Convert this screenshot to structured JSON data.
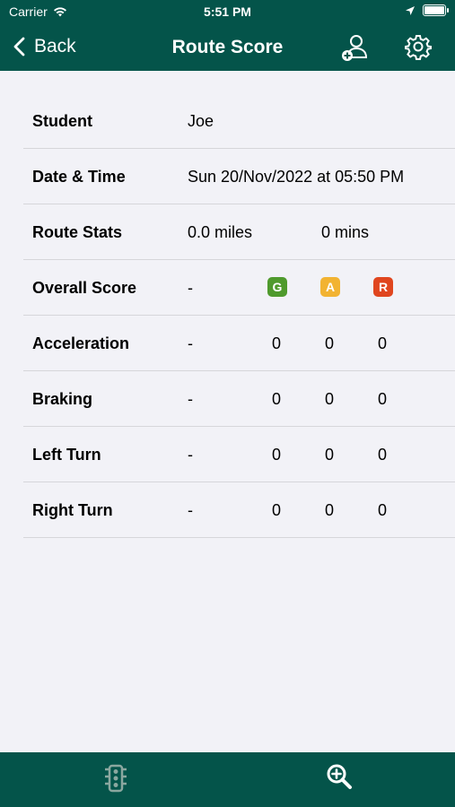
{
  "status_bar": {
    "carrier": "Carrier",
    "time": "5:51 PM"
  },
  "nav": {
    "back_label": "Back",
    "title": "Route Score",
    "icons": [
      "add-user-icon",
      "gear-icon"
    ]
  },
  "details": {
    "student": {
      "label": "Student",
      "value": "Joe"
    },
    "date_time": {
      "label": "Date & Time",
      "value": "Sun 20/Nov/2022 at 05:50 PM"
    },
    "route_stats": {
      "label": "Route Stats",
      "distance": "0.0 miles",
      "duration": "0 mins"
    }
  },
  "score_header": {
    "label": "Overall Score",
    "value": "-",
    "badges": [
      {
        "letter": "G",
        "color": "#4f9a2d"
      },
      {
        "letter": "A",
        "color": "#f2b332"
      },
      {
        "letter": "R",
        "color": "#e0461f"
      }
    ]
  },
  "score_rows": [
    {
      "label": "Acceleration",
      "value": "-",
      "g": "0",
      "a": "0",
      "r": "0"
    },
    {
      "label": "Braking",
      "value": "-",
      "g": "0",
      "a": "0",
      "r": "0"
    },
    {
      "label": "Left Turn",
      "value": "-",
      "g": "0",
      "a": "0",
      "r": "0"
    },
    {
      "label": "Right Turn",
      "value": "-",
      "g": "0",
      "a": "0",
      "r": "0"
    }
  ],
  "tab_bar": {
    "icons": [
      "traffic-light-icon",
      "zoom-in-icon"
    ]
  },
  "colors": {
    "primary": "#04544a",
    "background": "#f2f2f7"
  }
}
